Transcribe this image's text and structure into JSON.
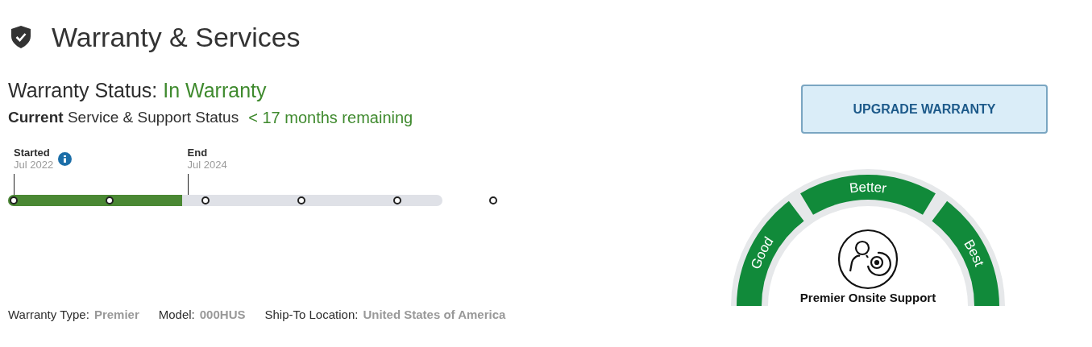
{
  "header": {
    "title": "Warranty & Services"
  },
  "status": {
    "label": "Warranty Status:",
    "value": "In Warranty"
  },
  "support": {
    "label": "**Current** Service & Support Status",
    "remaining": "< 17 months remaining"
  },
  "timeline": {
    "level": 0.4,
    "markers": [
      {
        "label": "Started",
        "date": "Jul 2022",
        "info": true
      },
      {
        "label": "End",
        "date": "Jul 2024",
        "info": false
      }
    ]
  },
  "upgrade_button": "UPGRADE WARRANTY",
  "gauge": {
    "tiers": [
      "Good",
      "Better",
      "Best"
    ],
    "name": "Premier Onsite Support"
  },
  "details": [
    {
      "label": "Warranty Type:",
      "value": "Premier"
    },
    {
      "label": "Model:",
      "value": "000HUS"
    },
    {
      "label": "Ship-To Location:",
      "value": "United States of America"
    }
  ]
}
